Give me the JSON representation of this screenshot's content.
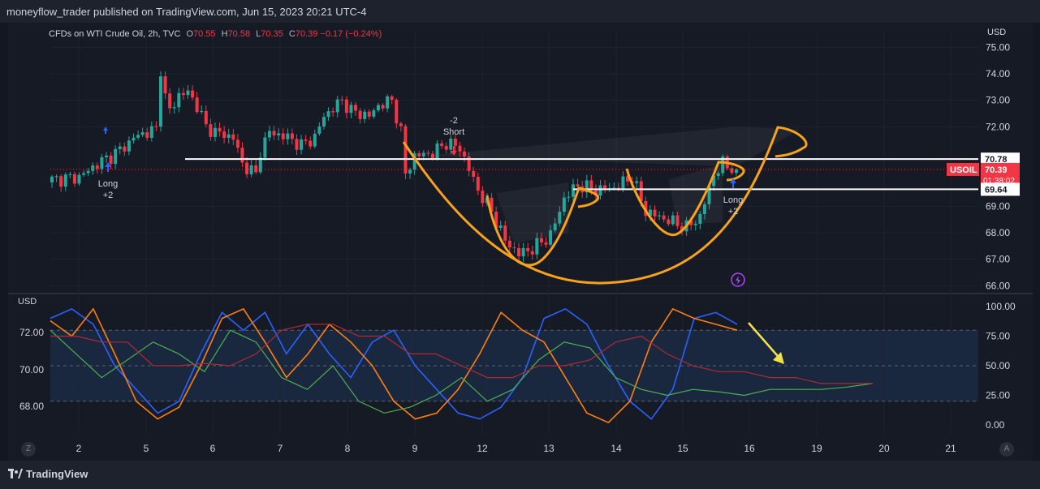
{
  "header": {
    "publisher_line": "moneyflow_trader published on TradingView.com, Jun 15, 2023 20:21 UTC-4"
  },
  "legend": {
    "symbol": "CFDs on WTI Crude Oil, 2h, TVC",
    "o_label": "O",
    "o": "70.55",
    "h_label": "H",
    "h": "70.58",
    "l_label": "L",
    "l": "70.35",
    "c_label": "C",
    "c": "70.39",
    "change": "−0.17 (−0.24%)"
  },
  "axes": {
    "main_currency": "USD",
    "osc_currency": "USD"
  },
  "annotations": {
    "long1": [
      "Long",
      "+2"
    ],
    "short": [
      "-2",
      "Short"
    ],
    "long2": [
      "Long",
      "+2"
    ],
    "price_tag_symbol": "USOIL",
    "price_tag_value": "70.39",
    "price_tag_countdown": "01:38:02",
    "level_high": "70.78",
    "level_low": "69.64"
  },
  "footer": {
    "brand": "TradingView",
    "left_btn": "Z",
    "right_btn": "A"
  },
  "colors": {
    "up": "#26a69a",
    "down": "#f23645",
    "drawing": "#f7a21b",
    "arrow": "#f2e14a",
    "price_tag": "#f23645"
  },
  "chart_data": [
    {
      "type": "candlestick",
      "title": "CFDs on WTI Crude Oil, 2h, TVC",
      "ylabel": "USD",
      "y_ticks": [
        "75.00",
        "74.00",
        "73.00",
        "72.00",
        "69.00",
        "68.00",
        "67.00",
        "66.00"
      ],
      "x_ticks": [
        "2",
        "5",
        "6",
        "7",
        "8",
        "9",
        "12",
        "13",
        "14",
        "15",
        "16",
        "19",
        "20",
        "21"
      ],
      "ylim": [
        65.9,
        75.2
      ],
      "horizontal_levels": [
        70.78,
        69.64
      ],
      "last_price": 70.39,
      "close_path": [
        [
          0,
          70.0
        ],
        [
          6,
          70.1
        ],
        [
          10,
          70.6
        ],
        [
          14,
          71.0
        ],
        [
          17,
          71.4
        ],
        [
          18,
          71.6
        ],
        [
          21,
          71.8
        ],
        [
          23,
          71.9
        ],
        [
          24,
          74.2
        ],
        [
          25,
          73.1
        ],
        [
          26,
          72.6
        ],
        [
          28,
          73.2
        ],
        [
          30,
          73.3
        ],
        [
          32,
          72.8
        ],
        [
          34,
          72.0
        ],
        [
          36,
          71.8
        ],
        [
          40,
          71.6
        ],
        [
          42,
          70.6
        ],
        [
          45,
          70.2
        ],
        [
          46,
          71.1
        ],
        [
          48,
          71.8
        ],
        [
          52,
          71.6
        ],
        [
          55,
          71.3
        ],
        [
          58,
          71.6
        ],
        [
          60,
          72.4
        ],
        [
          64,
          73.0
        ],
        [
          66,
          72.6
        ],
        [
          70,
          72.4
        ],
        [
          72,
          72.8
        ],
        [
          75,
          73.0
        ],
        [
          77,
          71.8
        ],
        [
          78,
          70.2
        ],
        [
          80,
          70.9
        ],
        [
          84,
          71.0
        ],
        [
          87,
          71.4
        ],
        [
          90,
          71.2
        ],
        [
          92,
          70.4
        ],
        [
          94,
          69.6
        ],
        [
          97,
          68.8
        ],
        [
          100,
          67.7
        ],
        [
          103,
          67.2
        ],
        [
          106,
          67.4
        ],
        [
          110,
          67.9
        ],
        [
          113,
          69.3
        ],
        [
          116,
          69.8
        ],
        [
          120,
          69.6
        ],
        [
          124,
          69.7
        ],
        [
          128,
          70.1
        ],
        [
          131,
          68.8
        ],
        [
          134,
          68.6
        ],
        [
          137,
          68.4
        ],
        [
          140,
          68.2
        ],
        [
          143,
          68.6
        ],
        [
          146,
          70.2
        ],
        [
          148,
          70.6
        ],
        [
          151,
          70.39
        ]
      ]
    },
    {
      "type": "line",
      "title": "",
      "ylabel": "USD",
      "y_ticks_left": [
        "72.00",
        "70.00",
        "68.00"
      ],
      "y_ticks_right": [
        "100.00",
        "75.00",
        "50.00",
        "25.00",
        "0.00"
      ],
      "ylim": [
        -8,
        108
      ],
      "guide_levels": [
        80,
        50,
        20
      ],
      "series": [
        {
          "values": [
            90,
            98,
            85,
            50,
            30,
            10,
            20,
            60,
            95,
            80,
            95,
            60,
            85,
            60,
            40,
            70,
            80,
            50,
            30,
            10,
            5,
            15,
            40,
            90,
            98,
            85,
            50,
            20,
            5,
            30,
            90,
            95,
            85
          ]
        },
        {
          "values": [
            88,
            75,
            98,
            60,
            20,
            5,
            15,
            50,
            90,
            98,
            70,
            40,
            60,
            85,
            70,
            50,
            20,
            5,
            10,
            30,
            60,
            95,
            80,
            70,
            40,
            10,
            2,
            20,
            70,
            98,
            90,
            85,
            80
          ]
        },
        {
          "values": [
            80,
            60,
            40,
            55,
            70,
            60,
            45,
            80,
            70,
            40,
            30,
            50,
            20,
            10,
            15,
            25,
            40,
            20,
            30,
            55,
            70,
            65,
            40,
            30,
            25,
            30,
            28,
            25,
            30,
            30,
            30,
            32,
            35
          ]
        },
        {
          "values": [
            75,
            75,
            70,
            70,
            50,
            50,
            52,
            50,
            60,
            80,
            85,
            85,
            75,
            75,
            60,
            60,
            50,
            40,
            40,
            50,
            50,
            55,
            70,
            75,
            60,
            50,
            45,
            45,
            40,
            40,
            35,
            35,
            35
          ]
        }
      ]
    }
  ]
}
